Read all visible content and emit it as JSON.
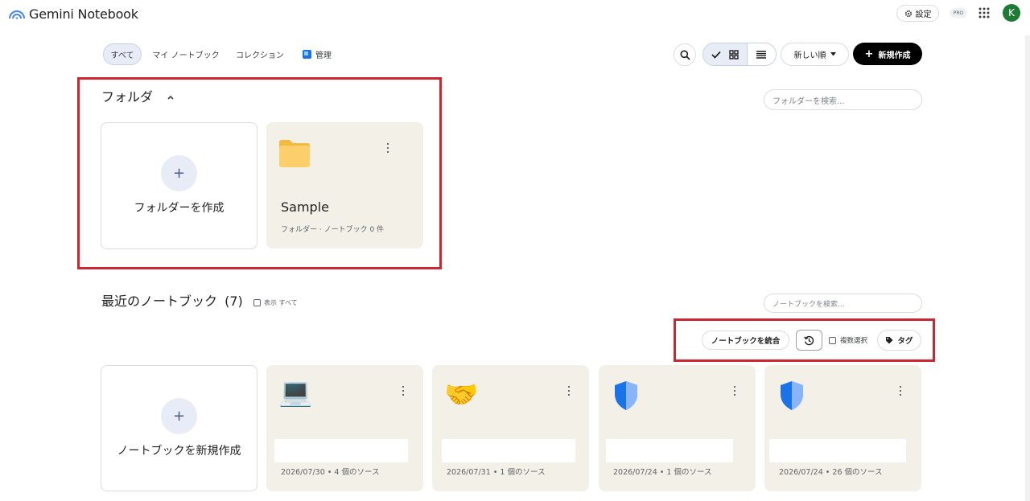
{
  "header": {
    "app_name": "Gemini Notebook",
    "settings_label": "設定",
    "pro_badge": "PRO",
    "avatar_initial": "K",
    "icons": [
      "gemini-logo-icon",
      "gear-icon",
      "apps-grid-icon"
    ]
  },
  "tabs": [
    {
      "label": "すべて",
      "active": true
    },
    {
      "label": "マイ ノートブック",
      "active": false
    },
    {
      "label": "コレクション",
      "active": false
    },
    {
      "label": "管理",
      "active": false
    }
  ],
  "toolbar": {
    "sort_label": "新しい順",
    "new_label": "新規作成",
    "view_mode": "grid"
  },
  "folders": {
    "title": "フォルダ",
    "search_placeholder": "フォルダーを検索...",
    "create_label": "フォルダーを作成",
    "items": [
      {
        "name": "Sample",
        "meta": "フォルダー · ノートブック 0 件"
      }
    ]
  },
  "notebooks": {
    "title": "最近のノートブック",
    "count": "(7)",
    "show_all_label": "表示 すべて",
    "search_placeholder": "ノートブックを検索...",
    "merge_label": "ノートブックを統合",
    "multi_select_label": "複数選択",
    "tag_label": "タグ",
    "create_label": "ノートブックを新規作成",
    "items": [
      {
        "emoji": "💻",
        "meta": "2026/07/30 • 4 個のソース"
      },
      {
        "emoji": "🤝",
        "meta": "2026/07/31 • 1 個のソース"
      },
      {
        "emoji": "🛡",
        "meta": "2026/07/24 • 1 個のソース"
      },
      {
        "emoji": "🛡",
        "meta": "2026/07/24 • 26 個のソース"
      }
    ]
  },
  "colors": {
    "highlight": "#cc2631",
    "card_bg": "#f2f0e7",
    "primary_button": "#000000",
    "avatar": "#1e7a34"
  }
}
